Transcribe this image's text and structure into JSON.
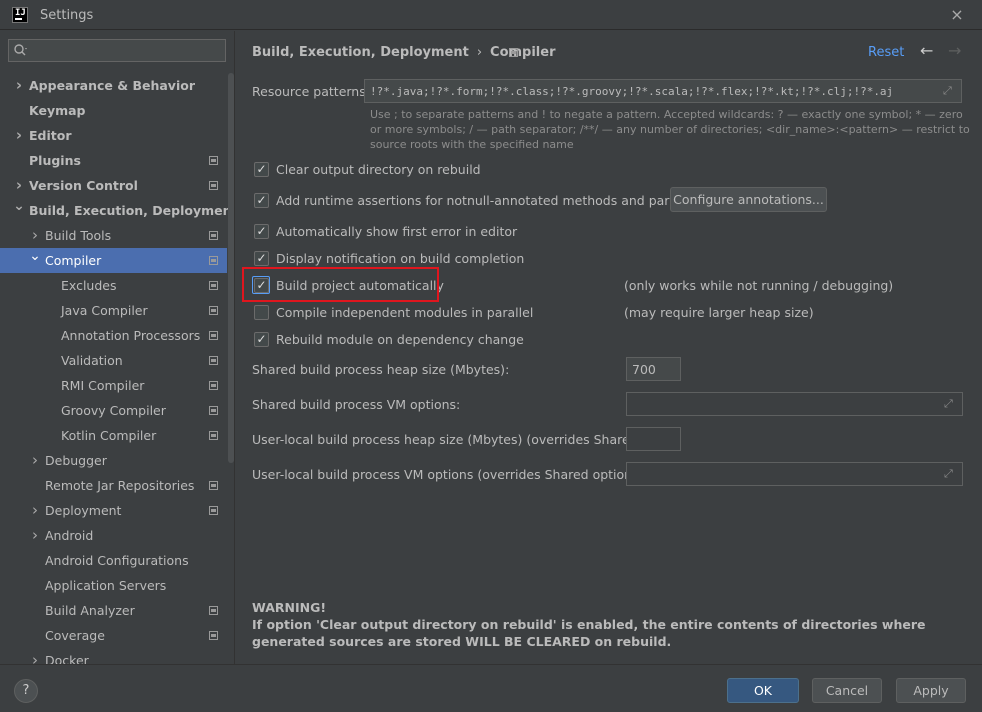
{
  "window": {
    "title": "Settings",
    "close_icon": "×"
  },
  "sidebar": {
    "search_placeholder": "",
    "items": [
      {
        "label": "Appearance & Behavior",
        "level": 0,
        "bold": true,
        "expanded": false,
        "has_children": true,
        "page_icon": false
      },
      {
        "label": "Keymap",
        "level": 0,
        "bold": true,
        "has_children": false,
        "page_icon": false
      },
      {
        "label": "Editor",
        "level": 0,
        "bold": true,
        "expanded": false,
        "has_children": true,
        "page_icon": false
      },
      {
        "label": "Plugins",
        "level": 0,
        "bold": true,
        "has_children": false,
        "page_icon": true
      },
      {
        "label": "Version Control",
        "level": 0,
        "bold": true,
        "expanded": false,
        "has_children": true,
        "page_icon": true
      },
      {
        "label": "Build, Execution, Deployment",
        "level": 0,
        "bold": true,
        "expanded": true,
        "has_children": true,
        "page_icon": false
      },
      {
        "label": "Build Tools",
        "level": 1,
        "expanded": false,
        "has_children": true,
        "page_icon": true
      },
      {
        "label": "Compiler",
        "level": 1,
        "expanded": true,
        "has_children": true,
        "page_icon": true,
        "selected": true
      },
      {
        "label": "Excludes",
        "level": 2,
        "has_children": false,
        "page_icon": true
      },
      {
        "label": "Java Compiler",
        "level": 2,
        "has_children": false,
        "page_icon": true
      },
      {
        "label": "Annotation Processors",
        "level": 2,
        "has_children": false,
        "page_icon": true
      },
      {
        "label": "Validation",
        "level": 2,
        "has_children": false,
        "page_icon": true
      },
      {
        "label": "RMI Compiler",
        "level": 2,
        "has_children": false,
        "page_icon": true
      },
      {
        "label": "Groovy Compiler",
        "level": 2,
        "has_children": false,
        "page_icon": true
      },
      {
        "label": "Kotlin Compiler",
        "level": 2,
        "has_children": false,
        "page_icon": true
      },
      {
        "label": "Debugger",
        "level": 1,
        "expanded": false,
        "has_children": true,
        "page_icon": false
      },
      {
        "label": "Remote Jar Repositories",
        "level": 1,
        "has_children": false,
        "page_icon": true
      },
      {
        "label": "Deployment",
        "level": 1,
        "expanded": false,
        "has_children": true,
        "page_icon": true
      },
      {
        "label": "Android",
        "level": 1,
        "expanded": false,
        "has_children": true,
        "page_icon": false
      },
      {
        "label": "Android Configurations",
        "level": 1,
        "has_children": false,
        "page_icon": false
      },
      {
        "label": "Application Servers",
        "level": 1,
        "has_children": false,
        "page_icon": false
      },
      {
        "label": "Build Analyzer",
        "level": 1,
        "has_children": false,
        "page_icon": true
      },
      {
        "label": "Coverage",
        "level": 1,
        "has_children": false,
        "page_icon": true
      },
      {
        "label": "Docker",
        "level": 1,
        "expanded": false,
        "has_children": true,
        "page_icon": false
      }
    ]
  },
  "header": {
    "breadcrumb_parent": "Build, Execution, Deployment",
    "breadcrumb_separator": "›",
    "breadcrumb_current": "Compiler",
    "reset_label": "Reset",
    "back_icon": "←",
    "forward_icon": "→"
  },
  "resource_patterns": {
    "label": "Resource patterns:",
    "value": "!?*.java;!?*.form;!?*.class;!?*.groovy;!?*.scala;!?*.flex;!?*.kt;!?*.clj;!?*.aj",
    "hint": "Use ; to separate patterns and ! to negate a pattern. Accepted wildcards: ? — exactly one symbol; * — zero or more symbols; / — path separator; /**/ — any number of directories; <dir_name>:<pattern> — restrict to source roots with the specified name"
  },
  "options": [
    {
      "label": "Clear output directory on rebuild",
      "checked": true,
      "note": ""
    },
    {
      "label": "Add runtime assertions for notnull-annotated methods and parameters",
      "checked": true,
      "note": ""
    },
    {
      "label": "Automatically show first error in editor",
      "checked": true,
      "note": ""
    },
    {
      "label": "Display notification on build completion",
      "checked": true,
      "note": ""
    },
    {
      "label": "Build project automatically",
      "checked": true,
      "note": "(only works while not running / debugging)"
    },
    {
      "label": "Compile independent modules in parallel",
      "checked": false,
      "note": "(may require larger heap size)"
    },
    {
      "label": "Rebuild module on dependency change",
      "checked": true,
      "note": ""
    }
  ],
  "configure_annotations_label": "Configure annotations...",
  "fields": {
    "heap_label": "Shared build process heap size (Mbytes):",
    "heap_value": "700",
    "vm_label": "Shared build process VM options:",
    "vm_value": "",
    "user_heap_label": "User-local build process heap size (Mbytes) (overrides Shared size):",
    "user_heap_value": "",
    "user_vm_label": "User-local build process VM options (overrides Shared options):",
    "user_vm_value": ""
  },
  "warning": {
    "title": "WARNING!",
    "text": "If option 'Clear output directory on rebuild' is enabled, the entire contents of directories where generated sources are stored WILL BE CLEARED on rebuild."
  },
  "footer": {
    "help_label": "?",
    "ok_label": "OK",
    "cancel_label": "Cancel",
    "apply_label": "Apply"
  },
  "colors": {
    "background": "#3c3f41",
    "selection": "#4b6eaf",
    "link": "#589df6",
    "primary_button": "#365880",
    "highlight_box": "#e0161e"
  }
}
